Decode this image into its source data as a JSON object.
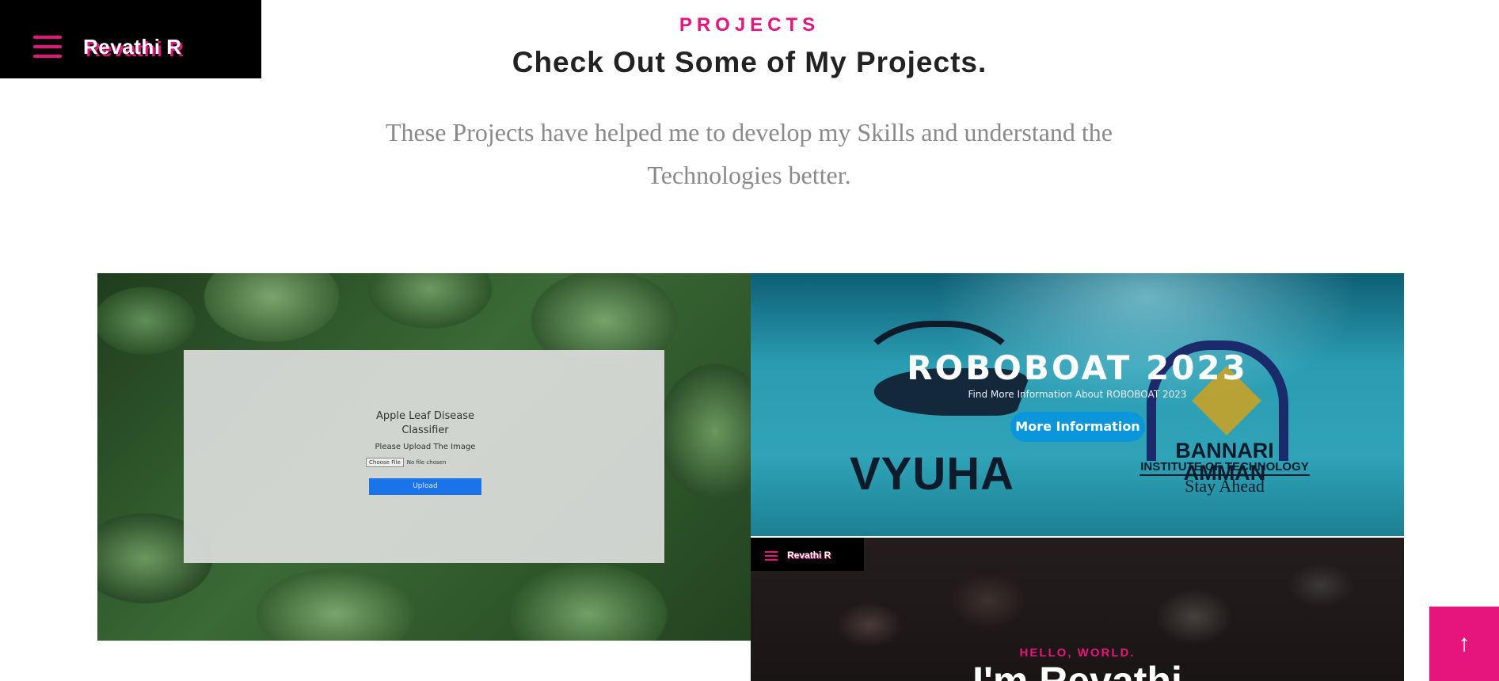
{
  "header": {
    "brand": "Revathi R",
    "menu_icon": "hamburger-menu-icon"
  },
  "section": {
    "kicker": "PROJECTS",
    "title": "Check Out Some of My Projects.",
    "description": "These Projects have helped me to develop my Skills and understand the Technologies better."
  },
  "projects": [
    {
      "app_title": "Apple Leaf Disease Classifier",
      "upload_prompt": "Please Upload The Image",
      "choose_file": "Choose File",
      "no_file": "No file chosen",
      "upload_button": "Upload"
    },
    {
      "title": "ROBOBOAT 2023",
      "subtitle": "Find More Information About ROBOBOAT 2023",
      "button": "More Information",
      "logo_left": "VYUHA",
      "logo_right_name": "BANNARI AMMAN",
      "logo_right_sub": "INSTITUTE OF TECHNOLOGY",
      "logo_right_tag": "Stay Ahead"
    },
    {
      "brand": "Revathi R",
      "hello": "HELLO, WORLD.",
      "headline": "I'm Revathi"
    }
  ],
  "back_to_top": {
    "icon": "arrow-up-icon",
    "label": "↑"
  },
  "colors": {
    "accent": "#e6157d",
    "heading": "#222222",
    "muted": "#8a8a8a",
    "button_blue": "#0b95db"
  }
}
